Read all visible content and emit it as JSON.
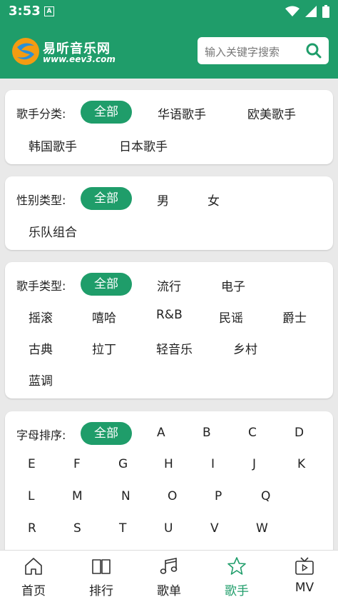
{
  "status": {
    "time": "3:53",
    "notif_letter": "A"
  },
  "header": {
    "logo_name": "易听音乐网",
    "logo_domain": "www.eev3.com",
    "search_placeholder": "输入关键字搜索"
  },
  "filters": {
    "category": {
      "label": "歌手分类:",
      "options": [
        "全部",
        "华语歌手",
        "欧美歌手",
        "韩国歌手",
        "日本歌手"
      ]
    },
    "gender": {
      "label": "性别类型:",
      "options": [
        "全部",
        "男",
        "女",
        "乐队组合"
      ]
    },
    "genre": {
      "label": "歌手类型:",
      "options": [
        "全部",
        "流行",
        "电子",
        "摇滚",
        "嘻哈",
        "R&B",
        "民谣",
        "爵士",
        "古典",
        "拉丁",
        "轻音乐",
        "乡村",
        "蓝调"
      ]
    },
    "letter": {
      "label": "字母排序:",
      "options": [
        "全部",
        "A",
        "B",
        "C",
        "D",
        "E",
        "F",
        "G",
        "H",
        "I",
        "J",
        "K",
        "L",
        "M",
        "N",
        "O",
        "P",
        "Q",
        "R",
        "S",
        "T",
        "U",
        "V",
        "W"
      ]
    }
  },
  "nav": {
    "items": [
      "首页",
      "排行",
      "歌单",
      "歌手",
      "MV"
    ],
    "active": "歌手"
  },
  "colors": {
    "accent": "#1f9d6a"
  }
}
